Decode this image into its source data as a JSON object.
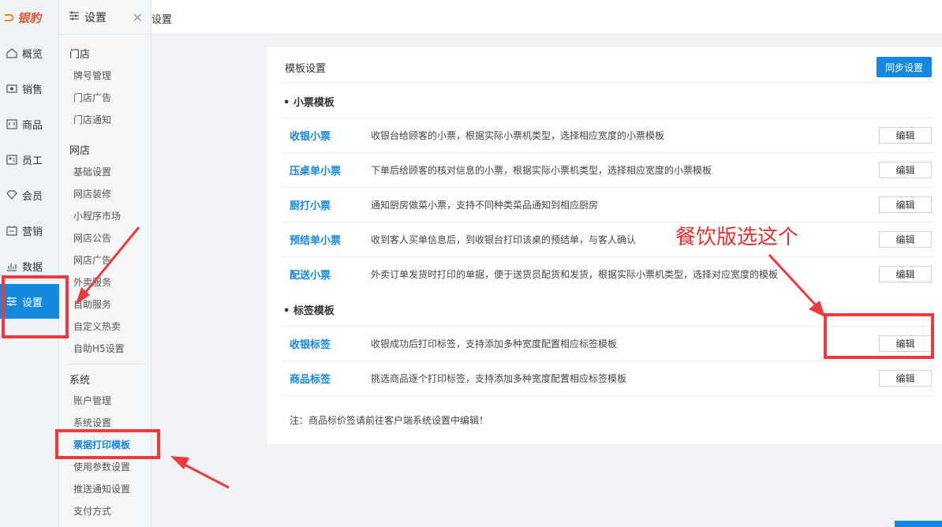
{
  "logo": {
    "text": "银豹"
  },
  "nav": {
    "items": [
      {
        "label": "概览",
        "icon": "home-icon"
      },
      {
        "label": "销售",
        "icon": "sales-icon"
      },
      {
        "label": "商品",
        "icon": "shop-icon"
      },
      {
        "label": "员工",
        "icon": "staff-icon"
      },
      {
        "label": "会员",
        "icon": "diamond-icon"
      },
      {
        "label": "营销",
        "icon": "marketing-icon"
      },
      {
        "label": "数据",
        "icon": "chart-icon"
      },
      {
        "label": "设置",
        "icon": "settings-icon"
      }
    ]
  },
  "submenu": {
    "title": "设置",
    "groups": [
      {
        "label": "门店",
        "items": [
          "牌号管理",
          "门店广告",
          "门店通知"
        ]
      },
      {
        "label": "网店",
        "items": [
          "基础设置",
          "网店装修",
          "小程序市场",
          "网店公告",
          "网店广告",
          "外卖服务",
          "自助服务",
          "自定义热卖",
          "自助H5设置"
        ]
      },
      {
        "label": "系统",
        "items": [
          "账户管理",
          "系统设置",
          "票据打印模板",
          "使用参数设置",
          "推送通知设置",
          "支付方式"
        ]
      }
    ]
  },
  "topbar": {
    "breadcrumb": "设置"
  },
  "panel": {
    "title": "模板设置",
    "sync_label": "同步设置",
    "sections": [
      {
        "label": "• 小票模板",
        "rows": [
          {
            "name": "收银小票",
            "desc": "收银台给顾客的小票，根据实际小票机类型，选择相应宽度的小票模板",
            "btn": "编辑"
          },
          {
            "name": "压桌单小票",
            "desc": "下单后给顾客的核对信息的小票，根据实际小票机类型，选择相应宽度的小票模板",
            "btn": "编辑"
          },
          {
            "name": "厨打小票",
            "desc": "通知厨房做菜小票，支持不同种类菜品通知到相应厨房",
            "btn": "编辑"
          },
          {
            "name": "预结单小票",
            "desc": "收到客人买单信息后，到收银台打印该桌的预结单，与客人确认",
            "btn": "编辑"
          },
          {
            "name": "配送小票",
            "desc": "外卖订单发货时打印的单据，便于送货员配货和发货，根据实际小票机类型，选择对应宽度的模板",
            "btn": "编辑"
          }
        ]
      },
      {
        "label": "• 标签模板",
        "rows": [
          {
            "name": "收银标签",
            "desc": "收银成功后打印标签，支持添加多种宽度配置相应标签模板",
            "btn": "编辑"
          },
          {
            "name": "商品标签",
            "desc": "挑选商品逐个打印标签，支持添加多种宽度配置相应标签模板",
            "btn": "编辑"
          }
        ]
      }
    ],
    "note": "注：商品标价签请前往客户端系统设置中编辑！"
  },
  "annotation": {
    "text": "餐饮版选这个",
    "color": "#e8302c"
  },
  "colors": {
    "accent": "#1589e0",
    "annotation_red": "#ee3a3a"
  }
}
